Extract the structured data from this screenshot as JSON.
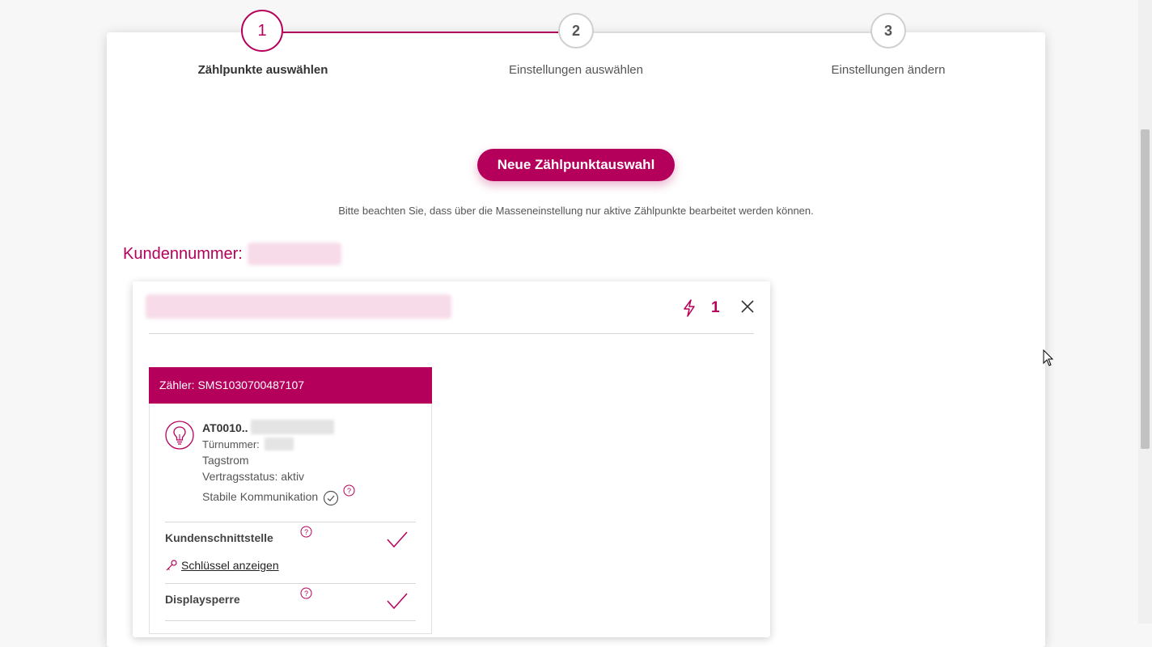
{
  "stepper": {
    "steps": [
      {
        "number": "1",
        "label": "Zählpunkte auswählen"
      },
      {
        "number": "2",
        "label": "Einstellungen auswählen"
      },
      {
        "number": "3",
        "label": "Einstellungen ändern"
      }
    ]
  },
  "main": {
    "new_selection_button": "Neue Zählpunktauswahl",
    "hint": "Bitte beachten Sie, dass über die Masseneinstellung nur aktive Zählpunkte bearbeitet werden können.",
    "customer_label": "Kundennummer:"
  },
  "panel": {
    "count": "1",
    "meter": {
      "header": "Zähler: SMS1030700487107",
      "id_prefix": "AT0010..",
      "door_label": "Türnummer:",
      "tariff": "Tagstrom",
      "contract_status": "Vertragsstatus: aktiv",
      "communication": "Stabile Kommunikation",
      "features": [
        {
          "label": "Kundenschnittstelle"
        },
        {
          "label": "Displaysperre"
        }
      ],
      "key_link": "Schlüssel anzeigen"
    }
  },
  "colors": {
    "accent": "#b5005b",
    "card_bg": "#ffffff",
    "page_bg": "#f7f7f7"
  },
  "icons": {
    "bolt": "bolt-icon",
    "close": "close-icon",
    "bulb": "lightbulb-icon",
    "help": "question-circle-icon",
    "check": "checkmark-icon",
    "key": "key-icon"
  }
}
